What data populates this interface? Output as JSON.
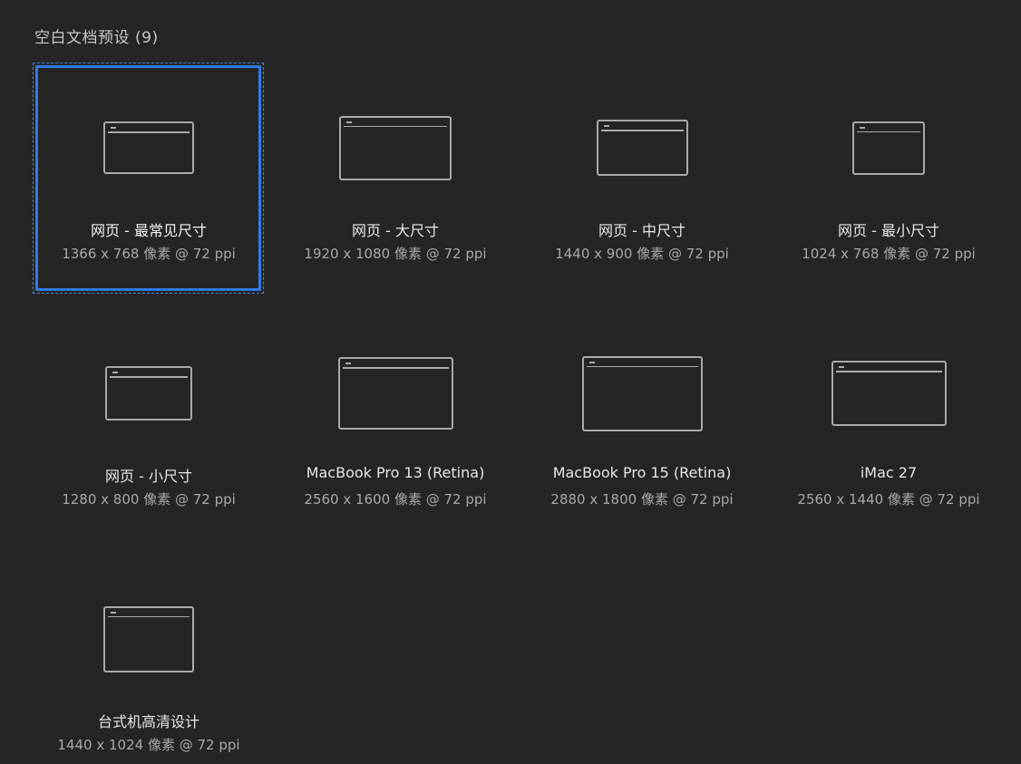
{
  "section": {
    "title": "空白文档预设",
    "count": "(9)"
  },
  "presets": [
    {
      "name": "网页 - 最常见尺寸",
      "size": "1366 x 768 像素 @ 72 ppi",
      "icon": "window-icon",
      "selected": true
    },
    {
      "name": "网页 - 大尺寸",
      "size": "1920 x 1080 像素 @ 72 ppi",
      "icon": "window-icon",
      "selected": false
    },
    {
      "name": "网页 - 中尺寸",
      "size": "1440 x 900 像素 @ 72 ppi",
      "icon": "window-icon",
      "selected": false
    },
    {
      "name": "网页 - 最小尺寸",
      "size": "1024 x 768 像素 @ 72 ppi",
      "icon": "window-icon",
      "selected": false
    },
    {
      "name": "网页 - 小尺寸",
      "size": "1280 x 800 像素 @ 72 ppi",
      "icon": "window-icon",
      "selected": false
    },
    {
      "name": "MacBook Pro 13 (Retina)",
      "size": "2560 x 1600 像素 @ 72 ppi",
      "icon": "window-icon",
      "selected": false
    },
    {
      "name": "MacBook Pro 15 (Retina)",
      "size": "2880 x 1800 像素 @ 72 ppi",
      "icon": "window-icon",
      "selected": false
    },
    {
      "name": "iMac 27",
      "size": "2560 x 1440 像素 @ 72 ppi",
      "icon": "window-icon",
      "selected": false
    },
    {
      "name": "台式机高清设计",
      "size": "1440 x 1024 像素 @ 72 ppi",
      "icon": "window-icon",
      "selected": false
    }
  ],
  "colors": {
    "background": "#252525",
    "selection": "#2f7be6",
    "icon_stroke": "#a9a9a9",
    "name_text": "#e6e6e6",
    "size_text": "#a8a8a8"
  }
}
